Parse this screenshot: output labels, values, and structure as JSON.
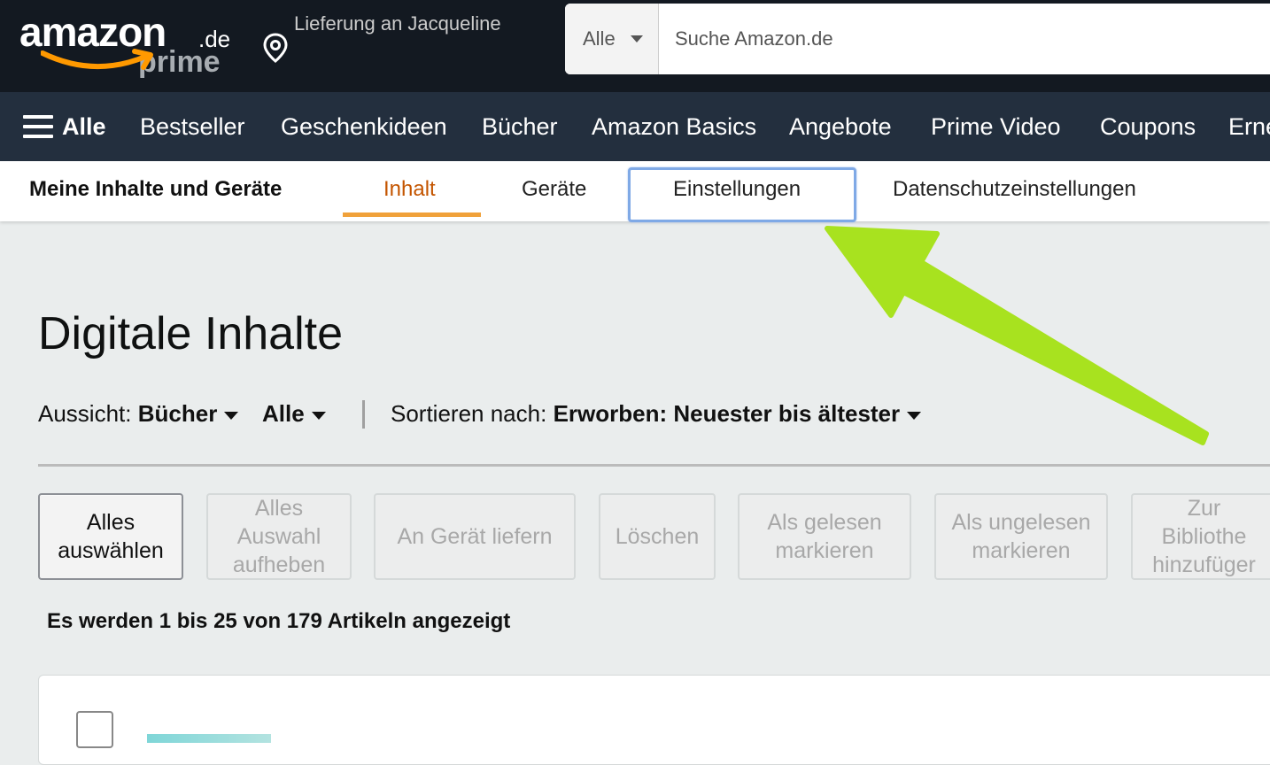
{
  "header": {
    "logo_word": "amazon",
    "logo_tld": ".de",
    "logo_prime": "prime",
    "delivery_text": "Lieferung an Jacqueline",
    "search_dept": "Alle",
    "search_placeholder": "Suche Amazon.de"
  },
  "nav": {
    "all_label": "Alle",
    "items": [
      "Bestseller",
      "Geschenkideen",
      "Bücher",
      "Amazon Basics",
      "Angebote",
      "Prime Video",
      "Coupons",
      "Erne"
    ]
  },
  "subnav": {
    "title": "Meine Inhalte und Geräte",
    "tabs": [
      "Inhalt",
      "Geräte",
      "Einstellungen",
      "Datenschutzeinstellungen"
    ],
    "active_tab": "Inhalt"
  },
  "main": {
    "title": "Digitale Inhalte",
    "view_label": "Aussicht:",
    "view_value": "Bücher",
    "view_filter": "Alle",
    "sort_label": "Sortieren nach:",
    "sort_value": "Erworben: Neuester bis ältester",
    "buttons": [
      {
        "label": "Alles\nauswählen",
        "enabled": true
      },
      {
        "label": "Alles\nAuswahl\naufheben",
        "enabled": false
      },
      {
        "label": "An Gerät liefern",
        "enabled": false
      },
      {
        "label": "Löschen",
        "enabled": false
      },
      {
        "label": "Als gelesen\nmarkieren",
        "enabled": false
      },
      {
        "label": "Als ungelesen\nmarkieren",
        "enabled": false
      },
      {
        "label": "Zur Bibliothe\nhinzufüger",
        "enabled": false
      }
    ],
    "count_text": "Es werden 1 bis 25 von 179 Artikeln angezeigt"
  },
  "colors": {
    "header_bg": "#131921",
    "nav_bg": "#232f3e",
    "active_tab": "#c45500",
    "tab_underline": "#f0a13a",
    "annotation_arrow": "#a8e21f",
    "logo_smile": "#ff9900"
  },
  "icons": [
    "location-pin-icon",
    "hamburger-menu-icon",
    "dropdown-caret-icon",
    "annotation-arrow-icon"
  ]
}
